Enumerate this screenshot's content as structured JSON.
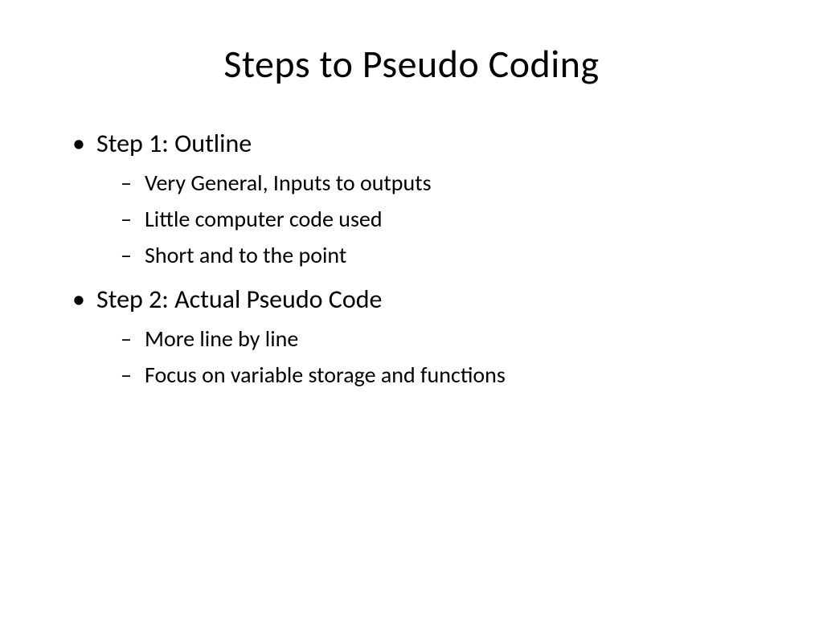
{
  "title": "Steps to Pseudo Coding",
  "bullets": [
    {
      "label": "Step 1: Outline",
      "children": [
        "Very General, Inputs to outputs",
        "Little computer code used",
        "Short and to the point"
      ]
    },
    {
      "label": "Step 2: Actual Pseudo Code",
      "children": [
        "More line by line",
        "Focus on variable storage and functions"
      ]
    }
  ]
}
